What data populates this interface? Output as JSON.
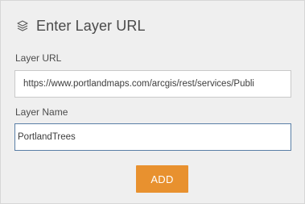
{
  "dialog": {
    "title": "Enter Layer URL",
    "title_icon": "layers-icon"
  },
  "layer_url": {
    "label": "Layer URL",
    "value": "https://www.portlandmaps.com/arcgis/rest/services/Publi"
  },
  "layer_name": {
    "label": "Layer Name",
    "value": "PortlandTrees"
  },
  "actions": {
    "add_label": "ADD"
  },
  "colors": {
    "panel_background": "#efefef",
    "add_button": "#e8912f",
    "focused_border": "#5a7fa6"
  }
}
